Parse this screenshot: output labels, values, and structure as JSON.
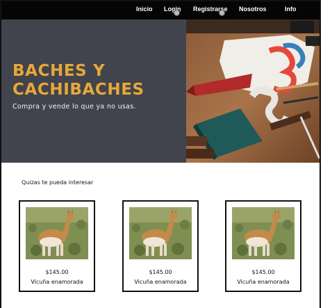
{
  "nav": {
    "items": [
      {
        "label": "Inicio"
      },
      {
        "label": "Login"
      },
      {
        "label": "Registrarse"
      },
      {
        "label": "Nosotros"
      },
      {
        "label": "Info"
      }
    ]
  },
  "hero": {
    "title_line1": "BACHES Y",
    "title_line2": "CACHIBACHES",
    "subtitle": "Compra y vende lo que ya no usas.",
    "accent_color": "#e7a83a",
    "background_color": "#41444c"
  },
  "products": {
    "section_label": "Quizas te pueda interesar",
    "items": [
      {
        "price": "$145.00",
        "name": "Vicuña enamorada",
        "image_icon": "vicuna-photo"
      },
      {
        "price": "$145.00",
        "name": "Vicuña enamorada",
        "image_icon": "vicuna-photo"
      },
      {
        "price": "$145.00",
        "name": "Vicuña enamorada",
        "image_icon": "vicuna-photo"
      }
    ]
  }
}
